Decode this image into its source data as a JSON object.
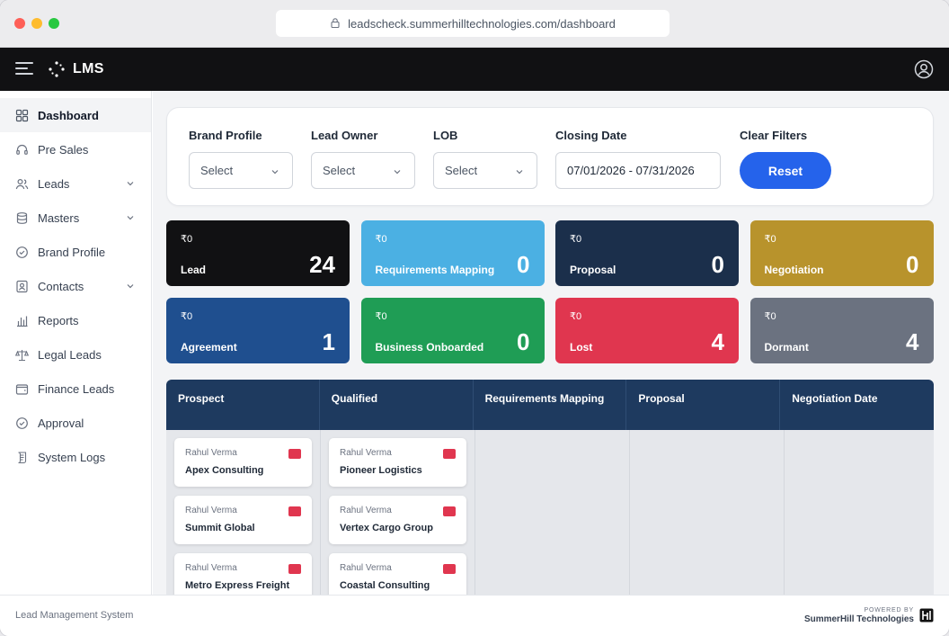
{
  "browser": {
    "url": "leadscheck.summerhilltechnologies.com/dashboard"
  },
  "app": {
    "name": "LMS"
  },
  "sidebar": {
    "items": [
      {
        "label": "Dashboard",
        "icon": "dashboard-grid-icon",
        "active": true,
        "expandable": false
      },
      {
        "label": "Pre Sales",
        "icon": "headset-icon",
        "active": false,
        "expandable": false
      },
      {
        "label": "Leads",
        "icon": "users-icon",
        "active": false,
        "expandable": true
      },
      {
        "label": "Masters",
        "icon": "database-icon",
        "active": false,
        "expandable": true
      },
      {
        "label": "Brand Profile",
        "icon": "badge-check-icon",
        "active": false,
        "expandable": false
      },
      {
        "label": "Contacts",
        "icon": "contact-card-icon",
        "active": false,
        "expandable": true
      },
      {
        "label": "Reports",
        "icon": "bar-chart-icon",
        "active": false,
        "expandable": false
      },
      {
        "label": "Legal Leads",
        "icon": "scale-icon",
        "active": false,
        "expandable": false
      },
      {
        "label": "Finance Leads",
        "icon": "wallet-icon",
        "active": false,
        "expandable": false
      },
      {
        "label": "Approval",
        "icon": "check-circle-icon",
        "active": false,
        "expandable": false
      },
      {
        "label": "System Logs",
        "icon": "scroll-icon",
        "active": false,
        "expandable": false
      }
    ]
  },
  "filters": {
    "brand_profile": {
      "label": "Brand Profile",
      "value": "Select"
    },
    "lead_owner": {
      "label": "Lead Owner",
      "value": "Select"
    },
    "lob": {
      "label": "LOB",
      "value": "Select"
    },
    "closing_date": {
      "label": "Closing Date",
      "value": "07/01/2026 - 07/31/2026"
    },
    "clear": {
      "label": "Clear Filters",
      "button": "Reset"
    }
  },
  "stage_cards": [
    {
      "amount": "₹0",
      "label": "Lead",
      "count": "24",
      "color": "#111113"
    },
    {
      "amount": "₹0",
      "label": "Requirements Mapping",
      "count": "0",
      "color": "#4bb0e3"
    },
    {
      "amount": "₹0",
      "label": "Proposal",
      "count": "0",
      "color": "#1b2f4b"
    },
    {
      "amount": "₹0",
      "label": "Negotiation",
      "count": "0",
      "color": "#b8932c"
    },
    {
      "amount": "₹0",
      "label": "Agreement",
      "count": "1",
      "color": "#1f4f8f"
    },
    {
      "amount": "₹0",
      "label": "Business Onboarded",
      "count": "0",
      "color": "#1f9d55"
    },
    {
      "amount": "₹0",
      "label": "Lost",
      "count": "4",
      "color": "#e0364f"
    },
    {
      "amount": "₹0",
      "label": "Dormant",
      "count": "4",
      "color": "#6b7280"
    }
  ],
  "board": {
    "columns": [
      {
        "title": "Prospect",
        "cards": [
          {
            "owner": "Rahul Verma",
            "company": "Apex Consulting"
          },
          {
            "owner": "Rahul Verma",
            "company": "Summit Global"
          },
          {
            "owner": "Rahul Verma",
            "company": "Metro Express Freight"
          }
        ]
      },
      {
        "title": "Qualified",
        "cards": [
          {
            "owner": "Rahul Verma",
            "company": "Pioneer Logistics"
          },
          {
            "owner": "Rahul Verma",
            "company": "Vertex Cargo Group"
          },
          {
            "owner": "Rahul Verma",
            "company": "Coastal Consulting"
          }
        ]
      },
      {
        "title": "Requirements Mapping",
        "cards": []
      },
      {
        "title": "Proposal",
        "cards": []
      },
      {
        "title": "Negotiation Date",
        "cards": []
      }
    ]
  },
  "footer": {
    "system": "Lead Management System",
    "powered_by": "POWERED BY",
    "brand": "SummerHill Technologies"
  }
}
